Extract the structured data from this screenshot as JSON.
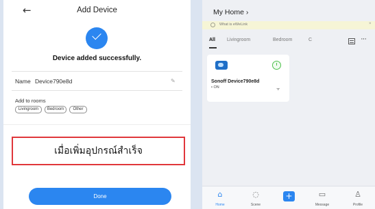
{
  "add_device": {
    "back_icon": "back-arrow-icon",
    "title": "Add Device",
    "success_icon": "check-circle-icon",
    "success_message": "Device added successfully.",
    "name_label": "Name",
    "name_value": "Device790e8d",
    "edit_icon": "edit-icon",
    "rooms_title": "Add to rooms",
    "rooms": [
      "Livingroom",
      "Bedroom",
      "Other"
    ],
    "caption": "เมื่อเพิ่มอุปกรณ์สำเร็จ",
    "done_label": "Done",
    "accent_color": "#2b86f0",
    "caption_border_color": "#e0363a"
  },
  "home": {
    "title": "My Home",
    "title_chevron": "›",
    "banner_text": "What is eWeLink",
    "banner_close": "×",
    "tabs": [
      "All",
      "Livingroom",
      "Bedroom",
      "C"
    ],
    "active_tab": "All",
    "more_label": "···",
    "device": {
      "icon": "sonoff-switch-icon",
      "power_icon": "power-icon",
      "name": "Sonoff Device790e8d",
      "status": "• ON",
      "wifi_icon": "wifi-icon"
    },
    "nav": [
      {
        "label": "Home",
        "icon": "home-icon",
        "active": true
      },
      {
        "label": "Scene",
        "icon": "scene-icon",
        "active": false
      },
      {
        "label": "",
        "icon": "add-icon",
        "active": false
      },
      {
        "label": "Message",
        "icon": "message-icon",
        "active": false
      },
      {
        "label": "Profile",
        "icon": "profile-icon",
        "active": false
      }
    ]
  }
}
